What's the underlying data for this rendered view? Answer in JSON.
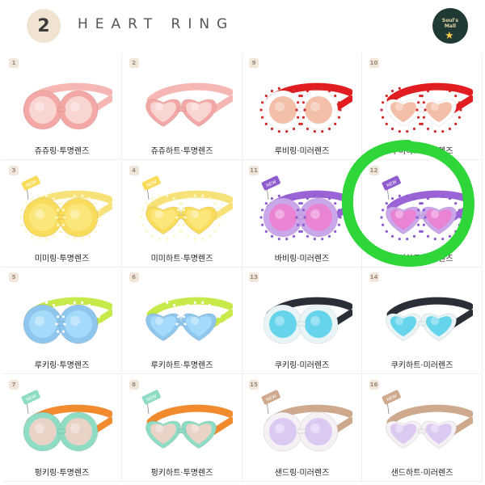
{
  "header": {
    "number": "2",
    "title": "HEART RING",
    "logo": {
      "line1": "Soul's",
      "line2": "Mall",
      "icon": "star-icon"
    }
  },
  "products": [
    {
      "tag": "1",
      "label": "쥬쥬링·투명렌즈",
      "lens": "ring",
      "strap": "#f6b6b4",
      "frame": "#f4a8a6",
      "lens_color": "#f9d9d6",
      "accent": "#f6b6b4",
      "new": false
    },
    {
      "tag": "2",
      "label": "쥬쥬하트·투명렌즈",
      "lens": "heart",
      "strap": "#f6b6b4",
      "frame": "#f4a8a6",
      "lens_color": "#f9d9d6",
      "accent": "#f6b6b4",
      "new": false
    },
    {
      "tag": "9",
      "label": "루비링·미러렌즈",
      "lens": "ring",
      "strap": "#e11d22",
      "frame": "#ffffff",
      "lens_color": "#f2b8a0",
      "accent": "#d12a2a",
      "new": false
    },
    {
      "tag": "10",
      "label": "루비하트·미러렌즈",
      "lens": "heart",
      "strap": "#e11d22",
      "frame": "#ffffff",
      "lens_color": "#f2b8a0",
      "accent": "#d12a2a",
      "new": false
    },
    {
      "tag": "3",
      "label": "미미링·투명렌즈",
      "lens": "ring",
      "strap": "#f7e27a",
      "frame": "#f9dc5c",
      "lens_color": "#fbe77d",
      "accent": "#f9dc5c",
      "new": true
    },
    {
      "tag": "4",
      "label": "미미하트·투명렌즈",
      "lens": "heart",
      "strap": "#f7e27a",
      "frame": "#f9dc5c",
      "lens_color": "#fbe77d",
      "accent": "#f9dc5c",
      "new": true
    },
    {
      "tag": "11",
      "label": "바비링·미러렌즈",
      "lens": "ring",
      "strap": "#9a63d6",
      "frame": "#caa7ea",
      "lens_color": "#ec7fd0",
      "accent": "#8f5bd1",
      "new": true
    },
    {
      "tag": "12",
      "label": "바비하트·미러렌즈",
      "lens": "heart",
      "strap": "#9a63d6",
      "frame": "#caa7ea",
      "lens_color": "#ec7fd0",
      "accent": "#8f5bd1",
      "new": true
    },
    {
      "tag": "5",
      "label": "루키링·투명렌즈",
      "lens": "ring",
      "strap": "#c7e94a",
      "frame": "#8fc6ee",
      "lens_color": "#a9dcfb",
      "accent": "#8fc6ee",
      "new": false
    },
    {
      "tag": "6",
      "label": "루키하트·투명렌즈",
      "lens": "heart",
      "strap": "#c7e94a",
      "frame": "#8fc6ee",
      "lens_color": "#a9dcfb",
      "accent": "#8fc6ee",
      "new": false
    },
    {
      "tag": "13",
      "label": "쿠키링·미러렌즈",
      "lens": "ring",
      "strap": "#2a2e36",
      "frame": "#e9f4f7",
      "lens_color": "#58d2ea",
      "accent": "#2a2e36",
      "new": false
    },
    {
      "tag": "14",
      "label": "쿠키하트·미러렌즈",
      "lens": "heart",
      "strap": "#2a2e36",
      "frame": "#e9f4f7",
      "lens_color": "#58d2ea",
      "accent": "#2a2e36",
      "new": false
    },
    {
      "tag": "7",
      "label": "펑키링·투명렌즈",
      "lens": "ring",
      "strap": "#f28a2e",
      "frame": "#8fdcc4",
      "lens_color": "#f3d1c8",
      "accent": "#8fdcc4",
      "new": true
    },
    {
      "tag": "8",
      "label": "펑키하트·투명렌즈",
      "lens": "heart",
      "strap": "#f28a2e",
      "frame": "#8fdcc4",
      "lens_color": "#f3d1c8",
      "accent": "#8fdcc4",
      "new": true
    },
    {
      "tag": "15",
      "label": "샌드링·미러렌즈",
      "lens": "ring",
      "strap": "#cfa98e",
      "frame": "#f4f0f3",
      "lens_color": "#d9c4f2",
      "accent": "#cfa98e",
      "new": true
    },
    {
      "tag": "16",
      "label": "샌드하트·미러렌즈",
      "lens": "heart",
      "strap": "#cfa98e",
      "frame": "#f4f0f3",
      "lens_color": "#d9c4f2",
      "accent": "#cfa98e",
      "new": true
    }
  ],
  "highlight": {
    "color": "#2fd63a",
    "target": "12"
  }
}
